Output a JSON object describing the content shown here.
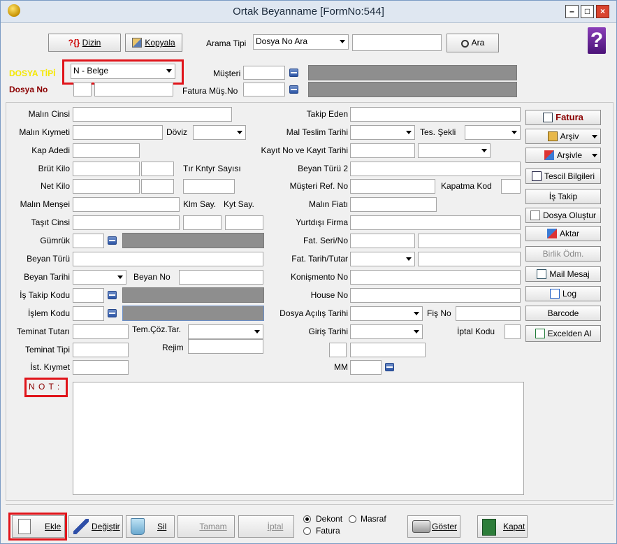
{
  "window": {
    "title": "Ortak Beyanname [FormNo:544]",
    "min": "–",
    "max": "□",
    "close": "×"
  },
  "toolbar": {
    "dizin": "Dizin",
    "kopyala": "Kopyala",
    "arama_tipi_label": "Arama Tipi",
    "arama_tipi_value": "Dosya No Ara",
    "ara": "Ara",
    "help": "?"
  },
  "header": {
    "dosya_tipi_label": "DOSYA TİPİ",
    "dosya_tipi_value": "N - Belge",
    "dosya_no_label": "Dosya No",
    "musteri_no_label": "Müşteri No",
    "fatura_mus_no_label": "Fatura Müş.No"
  },
  "left": {
    "malin_cinsi": "Malın Cinsi",
    "malin_kiymeti": "Malın Kıymeti",
    "doviz": "Döviz",
    "kap_adedi": "Kap Adedi",
    "brut_kilo": "Brüt Kilo",
    "tir_kntyr_sayisi": "Tır Kntyr Sayısı",
    "net_kilo": "Net Kilo",
    "malin_mensei": "Malın Menşei",
    "klm_say": "Klm Say.",
    "kyt_say": "Kyt Say.",
    "tasit_cinsi": "Taşıt Cinsi",
    "gumruk": "Gümrük",
    "beyan_turu": "Beyan Türü",
    "beyan_tarihi": "Beyan Tarihi",
    "beyan_no": "Beyan No",
    "is_takip_kodu": "İş Takip Kodu",
    "islem_kodu": "İşlem Kodu",
    "teminat_tutari": "Teminat Tutarı",
    "tem_coz_tar": "Tem.Çöz.Tar.",
    "teminat_tipi": "Teminat Tipi",
    "rejim": "Rejim",
    "ist_kiymet": "İst. Kıymet"
  },
  "right": {
    "takip_eden": "Takip Eden",
    "mal_teslim_tarihi": "Mal Teslim Tarihi",
    "tes_sekli": "Tes. Şekli",
    "kayit_no": "Kayıt No ve Kayıt Tarihi",
    "beyan_turu_2": "Beyan Türü 2",
    "musteri_ref_no": "Müşteri Ref. No",
    "kapatma_kod": "Kapatma Kod",
    "malin_fiati": "Malın Fiatı",
    "yurtdisi_firma": "Yurtdışı Firma",
    "fat_seri_no": "Fat. Seri/No",
    "fat_tarih_tutar": "Fat. Tarih/Tutar",
    "konismento_no": "Konişmento No",
    "house_no": "House No",
    "dosya_acilis_tarihi": "Dosya Açılış Tarihi",
    "fis_no": "Fiş No",
    "giris_tarihi": "Giriş Tarihi",
    "iptal_kodu": "İptal Kodu",
    "mm": "MM"
  },
  "side_buttons": [
    "Fatura",
    "Arşiv",
    "Arşivle",
    "Tescil Bilgileri",
    "İş Takip",
    "Dosya Oluştur",
    "Aktar",
    "Birlik Ödm.",
    "Mail Mesaj",
    "Log",
    "Barcode",
    "Excelden Al"
  ],
  "note": {
    "label": "N O T :"
  },
  "bottom": {
    "ekle": "Ekle",
    "degistir": "Değiştir",
    "sil": "Sil",
    "tamam": "Tamam",
    "iptal": "İptal",
    "dekont": "Dekont",
    "masraf": "Masraf",
    "fatura": "Fatura",
    "goster": "Göster",
    "kapat": "Kapat"
  },
  "colors": {
    "dosya_tipi": "#f5e800",
    "dosya_no": "#8b0000",
    "highlight": "#e0141a",
    "fatura": "#8b0000"
  }
}
